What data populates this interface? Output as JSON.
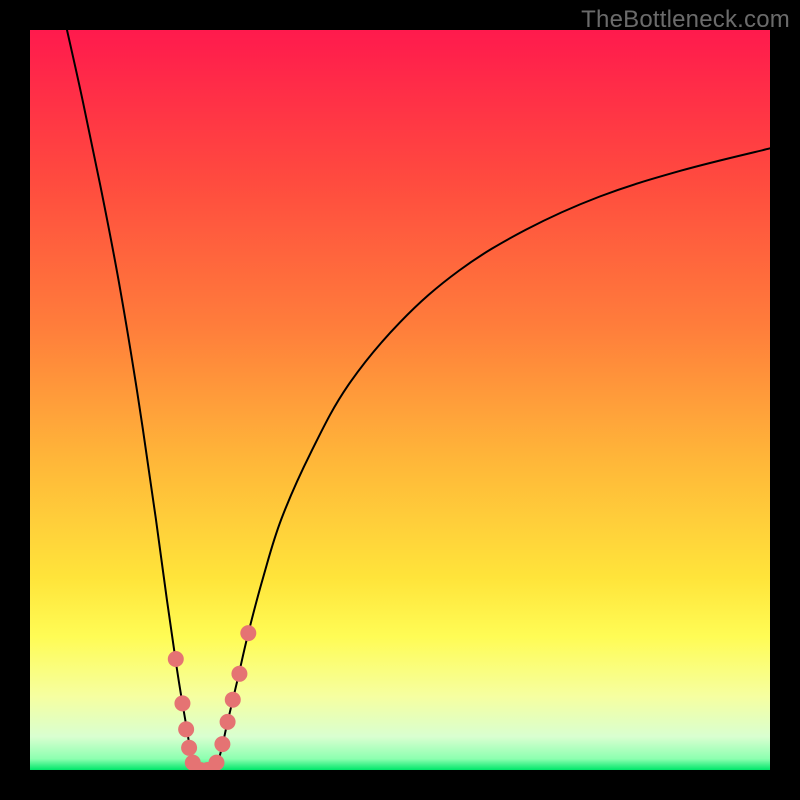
{
  "watermark": {
    "text": "TheBottleneck.com"
  },
  "chart_data": {
    "type": "line",
    "title": "",
    "xlabel": "",
    "ylabel": "",
    "xlim": [
      0,
      100
    ],
    "ylim": [
      0,
      100
    ],
    "grid": false,
    "legend": false,
    "background_gradient": {
      "stops": [
        {
          "offset": 0.0,
          "color": "#ff1a4d"
        },
        {
          "offset": 0.2,
          "color": "#ff4a3f"
        },
        {
          "offset": 0.4,
          "color": "#ff7d3b"
        },
        {
          "offset": 0.58,
          "color": "#ffb639"
        },
        {
          "offset": 0.74,
          "color": "#ffe43a"
        },
        {
          "offset": 0.82,
          "color": "#fffc55"
        },
        {
          "offset": 0.9,
          "color": "#f6ffa0"
        },
        {
          "offset": 0.955,
          "color": "#d9ffd0"
        },
        {
          "offset": 0.985,
          "color": "#8cffb0"
        },
        {
          "offset": 1.0,
          "color": "#00e66a"
        }
      ]
    },
    "series": [
      {
        "name": "bottleneck-curve-left",
        "type": "line",
        "color": "#000000",
        "stroke_width": 2,
        "x": [
          5.0,
          7.0,
          9.5,
          12.0,
          14.5,
          17.0,
          18.5,
          19.8,
          20.6,
          21.2,
          21.6,
          22.0,
          22.5
        ],
        "y": [
          100.0,
          91.0,
          79.0,
          66.0,
          51.0,
          34.0,
          23.0,
          14.0,
          9.0,
          5.5,
          3.0,
          1.0,
          0.0
        ]
      },
      {
        "name": "bottleneck-curve-right",
        "type": "line",
        "color": "#000000",
        "stroke_width": 2,
        "x": [
          25.0,
          25.8,
          26.7,
          28.0,
          29.5,
          31.5,
          34.0,
          38.0,
          43.0,
          50.0,
          58.0,
          67.0,
          77.0,
          88.0,
          100.0
        ],
        "y": [
          0.0,
          2.5,
          6.5,
          12.0,
          18.5,
          26.0,
          34.0,
          43.0,
          52.0,
          60.5,
          67.5,
          73.0,
          77.5,
          81.0,
          84.0
        ]
      },
      {
        "name": "datapoints",
        "type": "scatter",
        "color": "#e57373",
        "marker_radius": 8,
        "x": [
          19.7,
          20.6,
          21.1,
          21.5,
          22.0,
          23.0,
          24.0,
          25.2,
          26.0,
          26.7,
          27.4,
          28.3,
          29.5
        ],
        "y": [
          15.0,
          9.0,
          5.5,
          3.0,
          1.0,
          0.0,
          0.0,
          1.0,
          3.5,
          6.5,
          9.5,
          13.0,
          18.5
        ]
      }
    ]
  }
}
